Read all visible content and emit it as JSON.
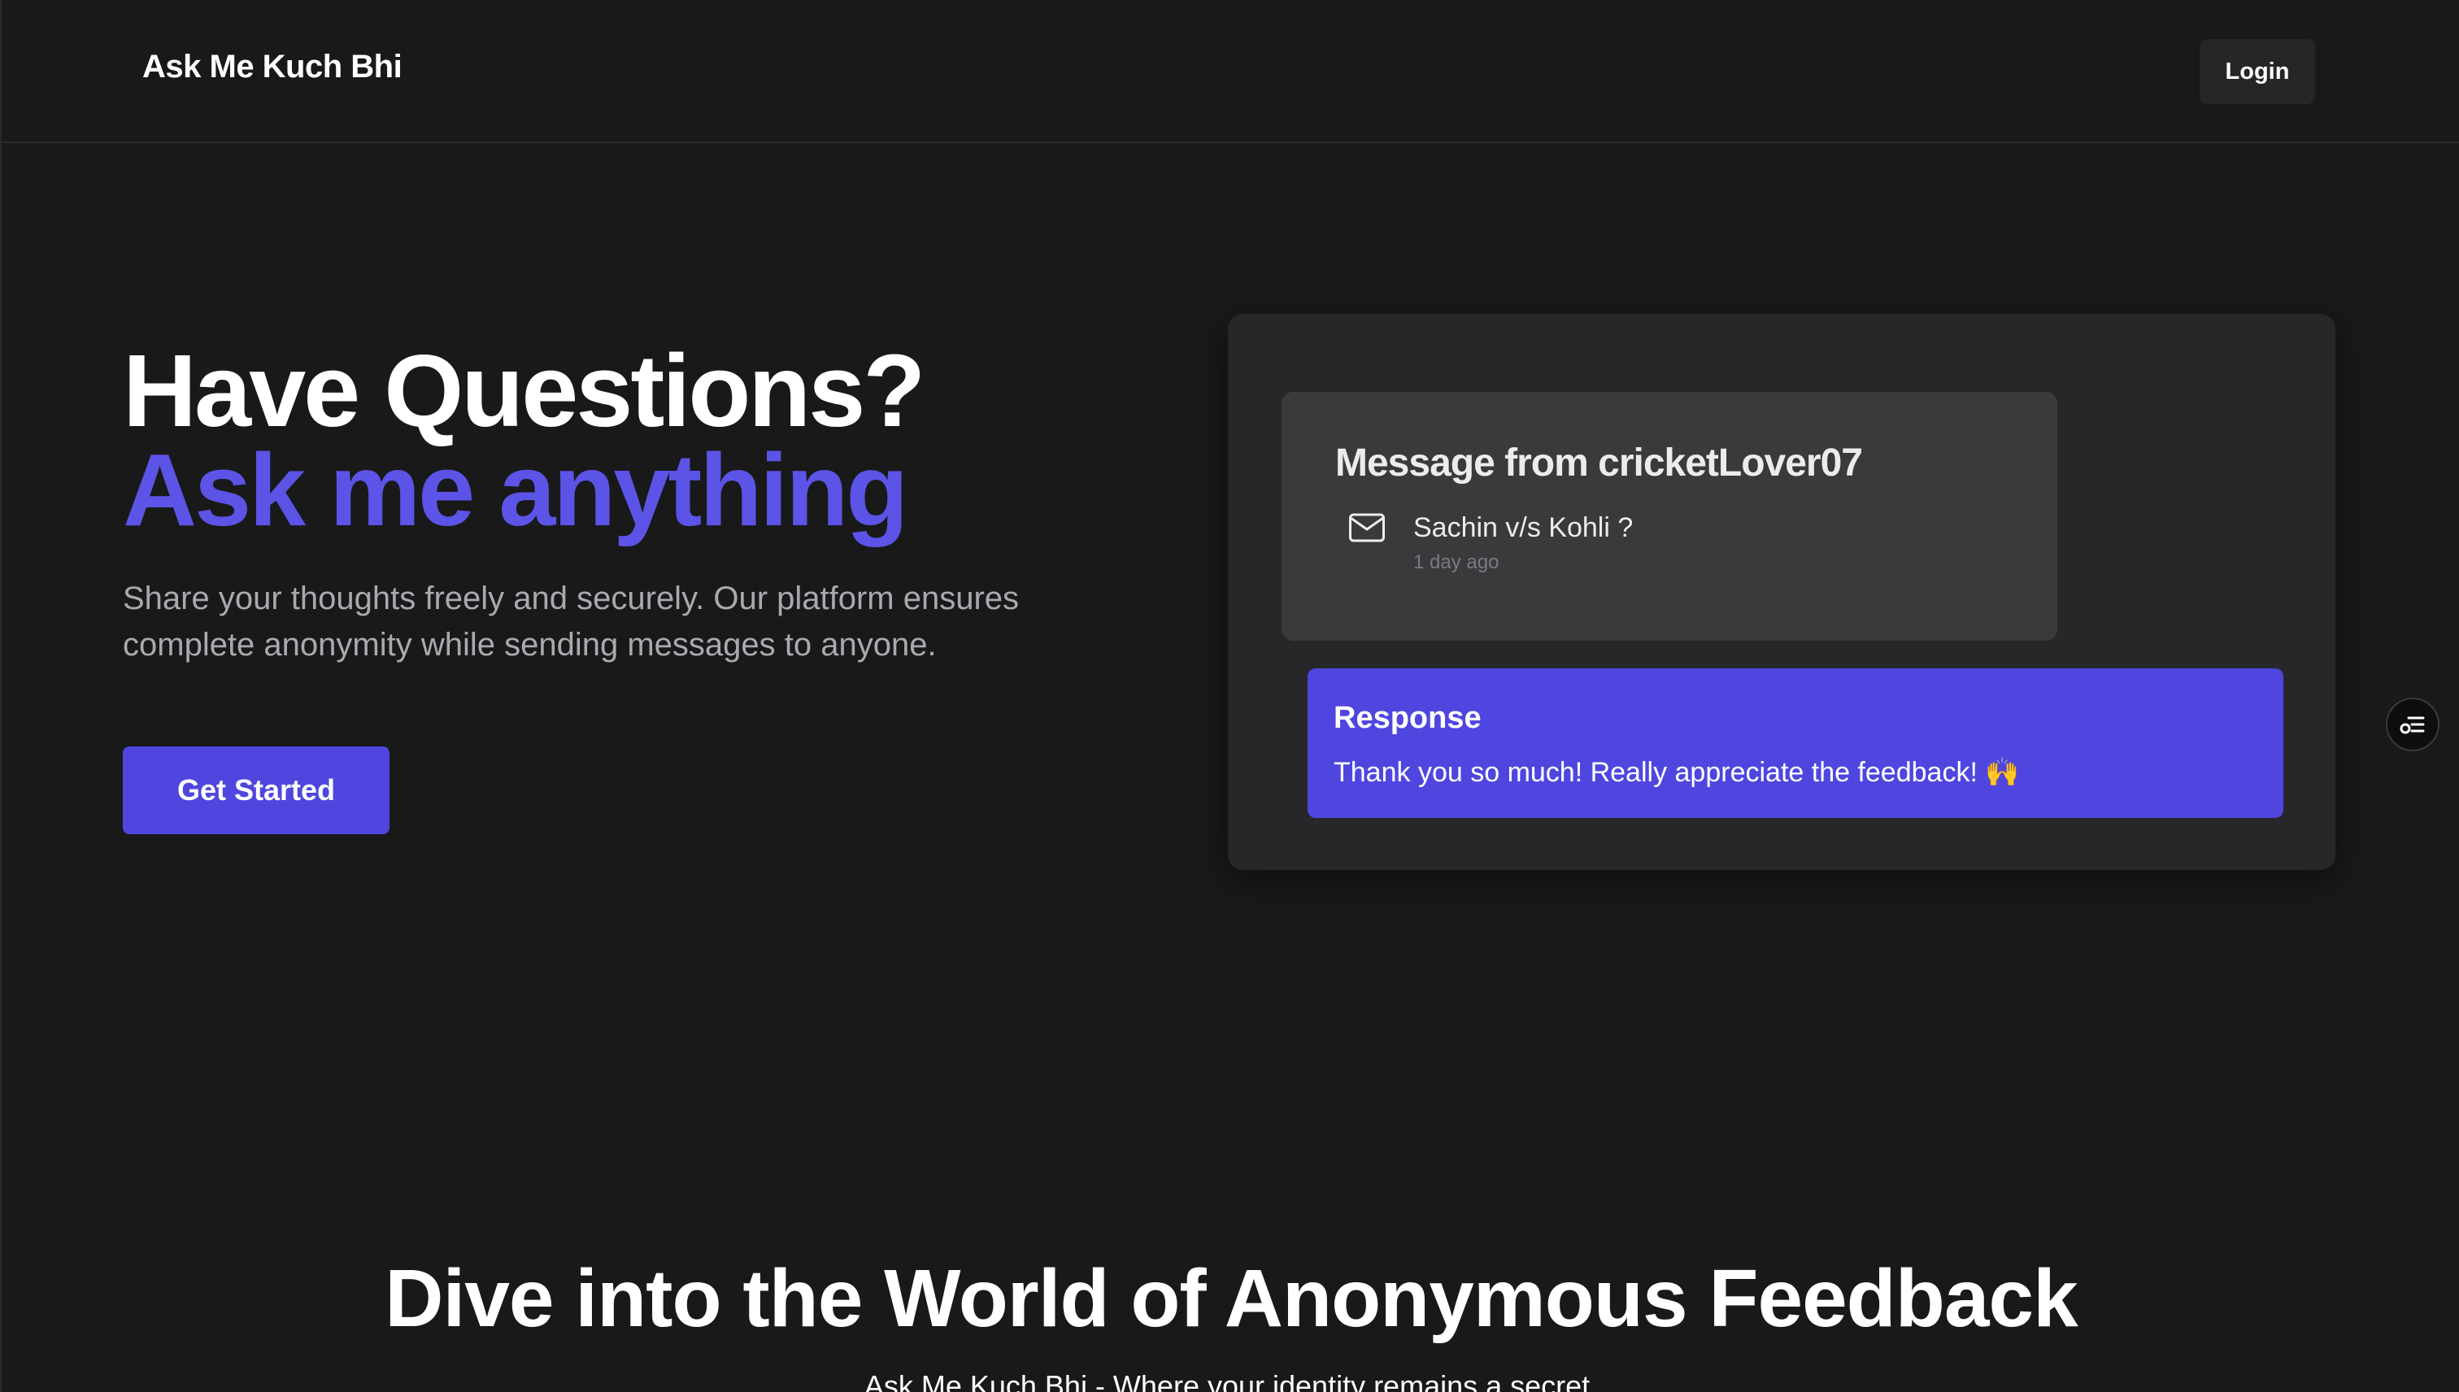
{
  "header": {
    "brand": "Ask Me Kuch Bhi",
    "login_label": "Login"
  },
  "hero": {
    "title": "Have Questions?",
    "accent": "Ask me anything",
    "description": "Share your thoughts freely and securely. Our platform ensures complete anonymity while sending messages to anyone.",
    "cta_label": "Get Started"
  },
  "showcase": {
    "message": {
      "title": "Message from cricketLover07",
      "icon": "mail-icon",
      "text": "Sachin v/s Kohli ?",
      "time": "1 day ago"
    },
    "response": {
      "title": "Response",
      "text": "Thank you so much! Really appreciate the feedback! 🙌"
    }
  },
  "side_button": {
    "icon": "settings-list-icon"
  },
  "section": {
    "title": "Dive into the World of Anonymous Feedback",
    "subtitle": "Ask Me Kuch Bhi - Where your identity remains a secret."
  },
  "colors": {
    "background": "#19191a",
    "accent": "#5b54e6",
    "button": "#4f46e0",
    "card": "#272729",
    "message_card": "#3a3a3c"
  }
}
